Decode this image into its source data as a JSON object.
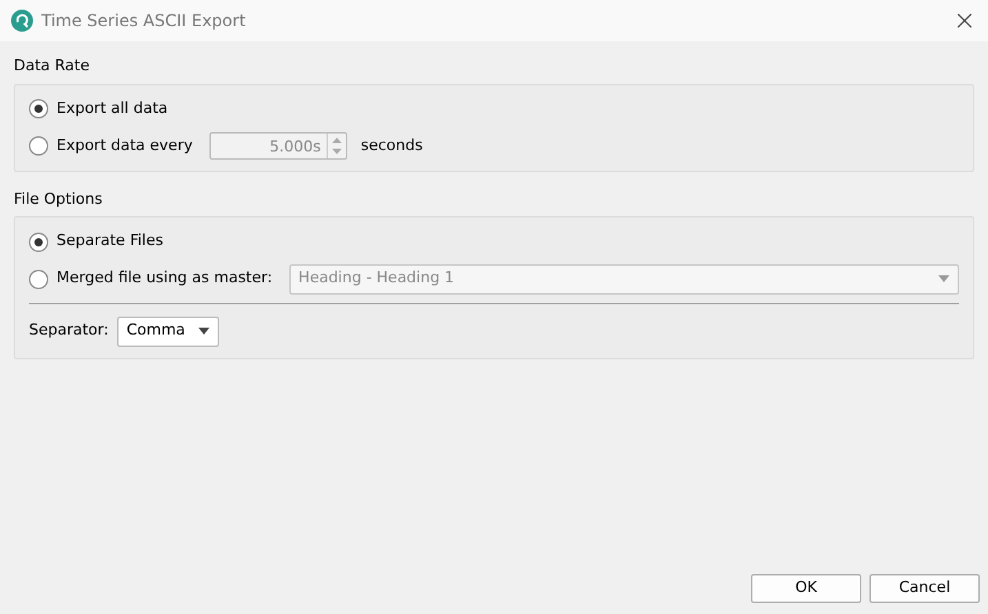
{
  "window": {
    "title": "Time Series ASCII Export"
  },
  "data_rate": {
    "title": "Data Rate",
    "options": [
      {
        "kind": "plain",
        "label": "Export all data",
        "selected": true
      },
      {
        "kind": "interval",
        "label": "Export data every",
        "selected": false,
        "spin": {
          "value": "5.000s",
          "disabled": true
        },
        "unit": "seconds"
      }
    ]
  },
  "file_options": {
    "title": "File Options",
    "options": [
      {
        "kind": "plain",
        "label": "Separate Files",
        "selected": true
      },
      {
        "kind": "master",
        "label": "Merged file using as master:",
        "selected": false,
        "combo": {
          "value": "Heading - Heading 1",
          "disabled": true
        }
      }
    ],
    "separator": {
      "label": "Separator:",
      "value": "Comma"
    }
  },
  "buttons": [
    "OK",
    "Cancel"
  ]
}
